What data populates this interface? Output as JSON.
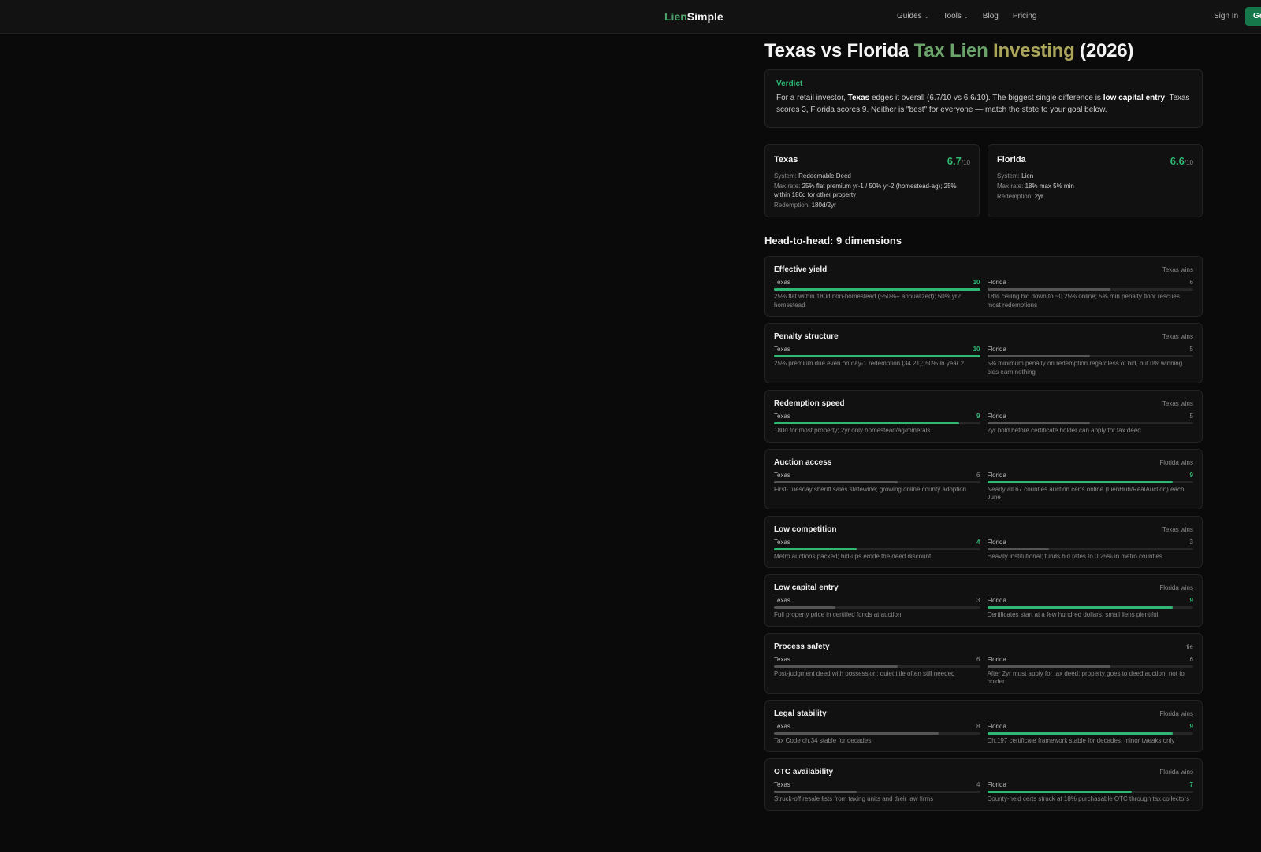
{
  "nav": {
    "logo_part1": "Lien",
    "logo_part2": "Simple",
    "links": [
      "Guides",
      "Tools",
      "Blog",
      "Pricing"
    ],
    "signin": "Sign In",
    "cta": "Ge"
  },
  "page": {
    "title_a": "Texas vs Florida ",
    "title_b": "Tax Lien ",
    "title_c": "Investing",
    "title_d": " (2026)"
  },
  "verdict": {
    "label": "Verdict",
    "t1": "For a retail investor, ",
    "t2": "Texas",
    "t3": " edges it overall (6.7/10 vs 6.6/10). The biggest single difference is ",
    "t4": "low capital entry",
    "t5": ": Texas scores 3, Florida scores 9. Neither is \"best\" for everyone — match the state to your goal below."
  },
  "states": [
    {
      "name": "Texas",
      "score": "6.7",
      "out_of": "/10",
      "system_label": "System: ",
      "system": "Redeemable Deed",
      "rate_label": "Max rate: ",
      "rate": "25% flat premium yr-1 / 50% yr-2 (homestead-ag); 25% within 180d for other property",
      "redemption_label": "Redemption: ",
      "redemption": "180d/2yr"
    },
    {
      "name": "Florida",
      "score": "6.6",
      "out_of": "/10",
      "system_label": "System: ",
      "system": "Lien",
      "rate_label": "Max rate: ",
      "rate": "18% max 5% min",
      "redemption_label": "Redemption: ",
      "redemption": "2yr"
    }
  ],
  "head_to_head_title": "Head-to-head: 9 dimensions",
  "dimensions": [
    {
      "name": "Effective yield",
      "winner": "Texas wins",
      "texas": 10,
      "florida": 6,
      "texas_note": "25% flat within 180d non-homestead (~50%+ annualized); 50% yr2 homestead",
      "florida_note": "18% ceiling bid down to ~0.25% online; 5% min penalty floor rescues most redemptions"
    },
    {
      "name": "Penalty structure",
      "winner": "Texas wins",
      "texas": 10,
      "florida": 5,
      "texas_note": "25% premium due even on day-1 redemption (34.21); 50% in year 2",
      "florida_note": "5% minimum penalty on redemption regardless of bid, but 0% winning bids earn nothing"
    },
    {
      "name": "Redemption speed",
      "winner": "Texas wins",
      "texas": 9,
      "florida": 5,
      "texas_note": "180d for most property; 2yr only homestead/ag/minerals",
      "florida_note": "2yr hold before certificate holder can apply for tax deed"
    },
    {
      "name": "Auction access",
      "winner": "Florida wins",
      "texas": 6,
      "florida": 9,
      "texas_note": "First-Tuesday sheriff sales statewide; growing online county adoption",
      "florida_note": "Nearly all 67 counties auction certs online (LienHub/RealAuction) each June"
    },
    {
      "name": "Low competition",
      "winner": "Texas wins",
      "texas": 4,
      "florida": 3,
      "texas_note": "Metro auctions packed; bid-ups erode the deed discount",
      "florida_note": "Heavily institutional; funds bid rates to 0.25% in metro counties"
    },
    {
      "name": "Low capital entry",
      "winner": "Florida wins",
      "texas": 3,
      "florida": 9,
      "texas_note": "Full property price in certified funds at auction",
      "florida_note": "Certificates start at a few hundred dollars; small liens plentiful"
    },
    {
      "name": "Process safety",
      "winner": "tie",
      "texas": 6,
      "florida": 6,
      "texas_note": "Post-judgment deed with possession; quiet title often still needed",
      "florida_note": "After 2yr must apply for tax deed; property goes to deed auction, not to holder"
    },
    {
      "name": "Legal stability",
      "winner": "Florida wins",
      "texas": 8,
      "florida": 9,
      "texas_note": "Tax Code ch.34 stable for decades",
      "florida_note": "Ch.197 certificate framework stable for decades, minor tweaks only"
    },
    {
      "name": "OTC availability",
      "winner": "Florida wins",
      "texas": 4,
      "florida": 7,
      "texas_note": "Struck-off resale lists from taxing units and their law firms",
      "florida_note": "County-held certs struck at 18% purchasable OTC through tax collectors"
    }
  ],
  "labels": {
    "texas": "Texas",
    "florida": "Florida"
  },
  "colors": {
    "accent": "#2fb874",
    "loser_bar": "#555555",
    "track": "#262626",
    "bg": "#0a0a0a",
    "card": "#111111"
  }
}
